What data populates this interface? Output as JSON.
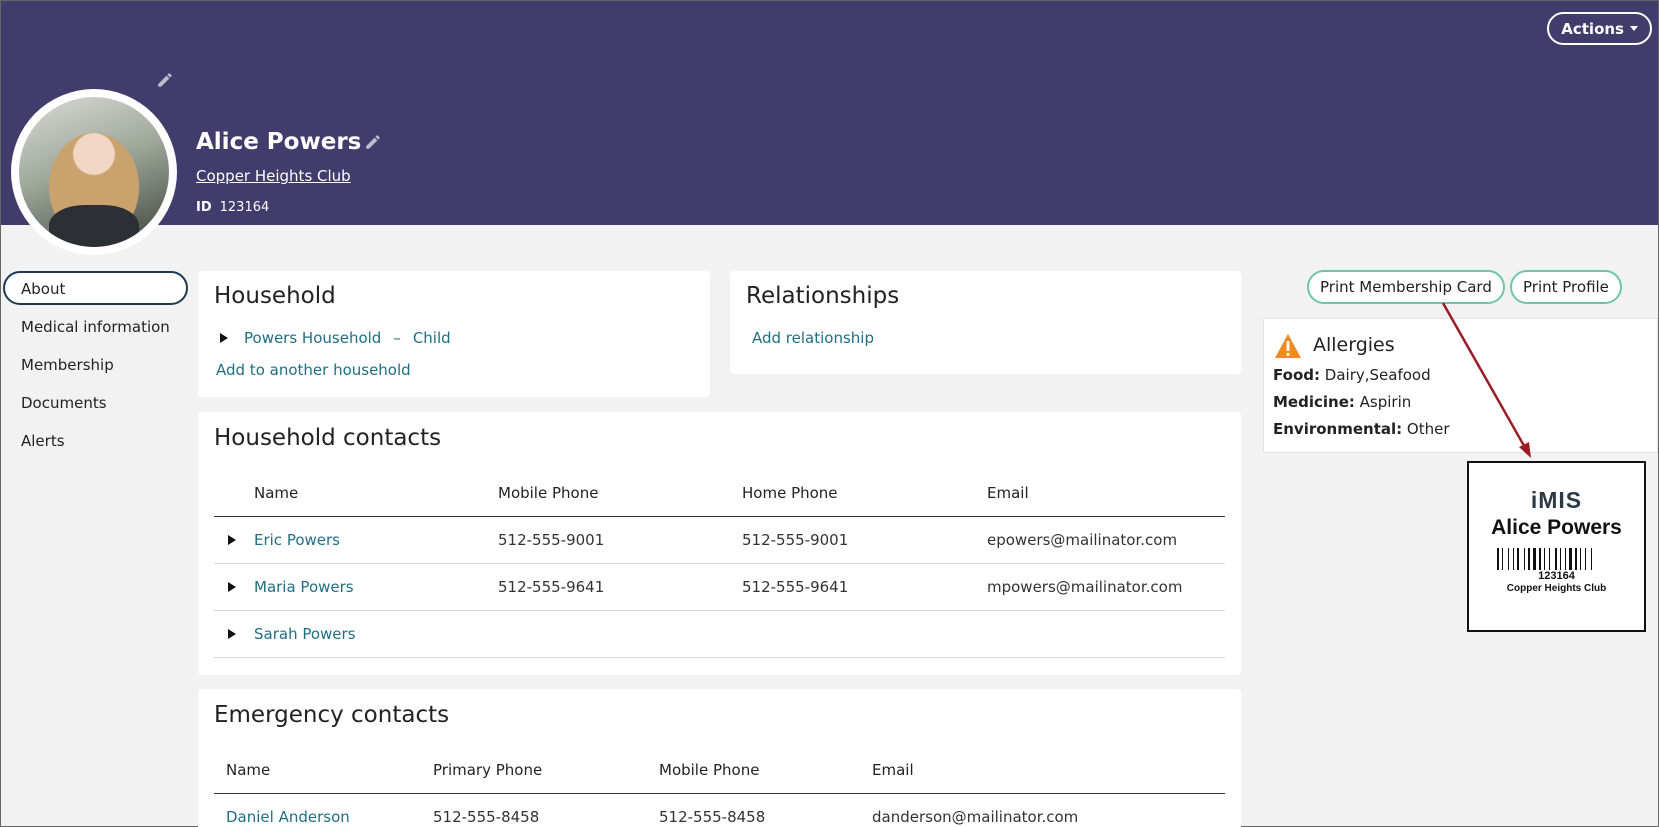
{
  "header": {
    "actions_label": "Actions",
    "member_name": "Alice Powers",
    "club_name": "Copper Heights Club",
    "id_label": "ID",
    "id_value": "123164",
    "bg_color": "#413c6b"
  },
  "nav": {
    "items": [
      {
        "label": "About",
        "active": true
      },
      {
        "label": "Medical information"
      },
      {
        "label": "Membership"
      },
      {
        "label": "Documents"
      },
      {
        "label": "Alerts"
      }
    ]
  },
  "household": {
    "title": "Household",
    "entry_name": "Powers Household",
    "entry_separator": "–",
    "entry_role": "Child",
    "add_label": "Add to another household"
  },
  "relationships": {
    "title": "Relationships",
    "add_label": "Add relationship"
  },
  "household_contacts": {
    "title": "Household contacts",
    "columns": [
      "Name",
      "Mobile Phone",
      "Home Phone",
      "Email"
    ],
    "rows": [
      {
        "name": "Eric Powers",
        "mobile": "512-555-9001",
        "home": "512-555-9001",
        "email": "epowers@mailinator.com"
      },
      {
        "name": "Maria Powers",
        "mobile": "512-555-9641",
        "home": "512-555-9641",
        "email": "mpowers@mailinator.com"
      },
      {
        "name": "Sarah Powers",
        "mobile": "",
        "home": "",
        "email": ""
      }
    ]
  },
  "emergency_contacts": {
    "title": "Emergency contacts",
    "columns": [
      "Name",
      "Primary Phone",
      "Mobile Phone",
      "Email"
    ],
    "rows": [
      {
        "name": "Daniel Anderson",
        "primary": "512-555-8458",
        "mobile": "512-555-8458",
        "email": "danderson@mailinator.com"
      }
    ]
  },
  "print": {
    "membership_card_label": "Print Membership Card",
    "profile_label": "Print Profile",
    "accent_color": "#6fc6a5"
  },
  "allergies": {
    "title": "Allergies",
    "icon": "warning-icon",
    "items": [
      {
        "label": "Food:",
        "value": "Dairy,Seafood"
      },
      {
        "label": "Medicine:",
        "value": "Aspirin"
      },
      {
        "label": "Environmental:",
        "value": "Other"
      }
    ]
  },
  "membership_card": {
    "logo_text": "iMIS",
    "name": "Alice Powers",
    "id": "123164",
    "club": "Copper Heights Club"
  },
  "annotation": {
    "arrow_color": "#9b1c24"
  }
}
